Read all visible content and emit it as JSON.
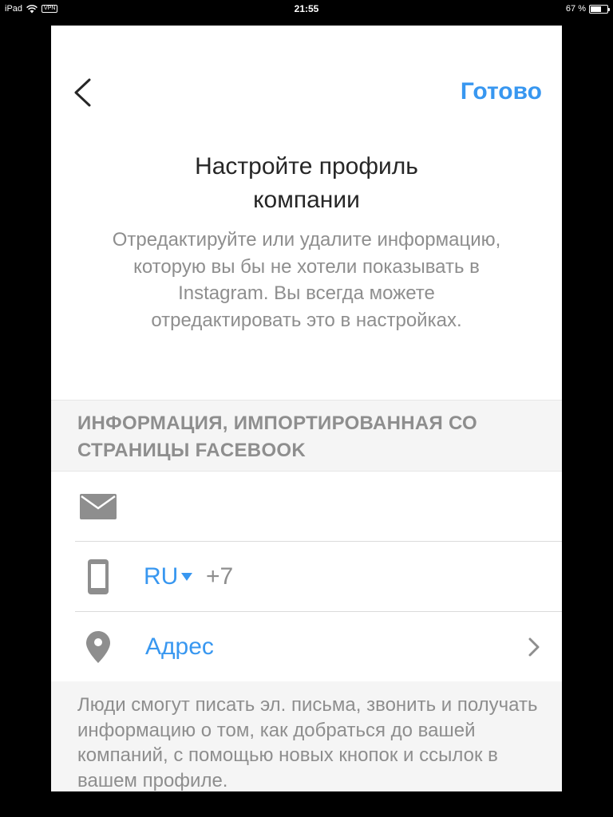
{
  "status_bar": {
    "device": "iPad",
    "vpn": "VPN",
    "time": "21:55",
    "battery_text": "67 %",
    "battery_level": 0.67
  },
  "header": {
    "done_label": "Готово"
  },
  "intro": {
    "title_line1": "Настройте профиль",
    "title_line2": "компании",
    "subtitle": "Отредактируйте или удалите информацию, которую вы бы не хотели показывать в Instagram. Вы всегда можете отредактировать это в настройках."
  },
  "section": {
    "header_line1": "ИНФОРМАЦИЯ, ИМПОРТИРОВАННАЯ СО",
    "header_line2": "СТРАНИЦЫ FACEBOOK"
  },
  "fields": {
    "country_code": "RU",
    "phone_prefix": "+7",
    "address_label": "Адрес"
  },
  "footer": {
    "text": "Люди смогут писать эл. письма, звонить и получать информацию о том, как добраться до вашей компаний, с помощью новых кнопок и ссылок в вашем профиле."
  },
  "colors": {
    "accent": "#3897f0",
    "secondary_text": "#8e8e8e",
    "icon_gray": "#8e8e8e"
  },
  "icons": [
    "wifi-icon",
    "battery-icon",
    "back-chevron-icon",
    "email-icon",
    "phone-icon",
    "location-pin-icon",
    "caret-down-icon",
    "chevron-right-icon"
  ]
}
